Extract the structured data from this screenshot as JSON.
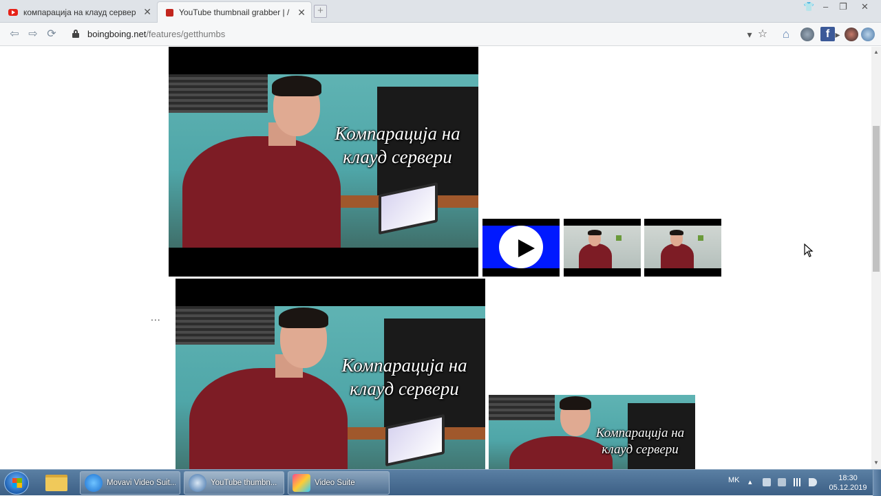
{
  "browser": {
    "tabs": [
      {
        "title": "компарација на клауд сервери -",
        "active": false
      },
      {
        "title": "YouTube thumbnail grabber | / Bo",
        "active": true
      }
    ],
    "close_glyph": "✕",
    "newtab_glyph": "+",
    "url": {
      "domain": "boingboing.net",
      "path": "/features/getthumbs"
    },
    "nav": {
      "back": "⇦",
      "forward": "⇨",
      "reload": "⟳"
    },
    "toolbar_glyphs": {
      "dropdown": "▾",
      "star": "☆",
      "home": "⌂",
      "arrow": "▸"
    },
    "facebook_letter": "f",
    "window_controls": {
      "shirt": "👕",
      "minimize": "–",
      "restore": "❐",
      "close": "✕"
    }
  },
  "page": {
    "thumbnail_caption_line1": "Компарација на",
    "thumbnail_caption_line2": "клауд сервери",
    "ellipsis": "..."
  },
  "taskbar": {
    "items": [
      {
        "label": "Movavi Video Suit..."
      },
      {
        "label": "YouTube thumbn..."
      },
      {
        "label": "Video Suite"
      }
    ],
    "language": "MK",
    "tray_arrow": "▴",
    "time": "18:30",
    "date": "05.12.2019"
  },
  "colors": {
    "youtube_red": "#e62117",
    "play_blue": "#0019ff",
    "shirt_red": "#7d1c25",
    "taskbar": "#3c5f85"
  }
}
